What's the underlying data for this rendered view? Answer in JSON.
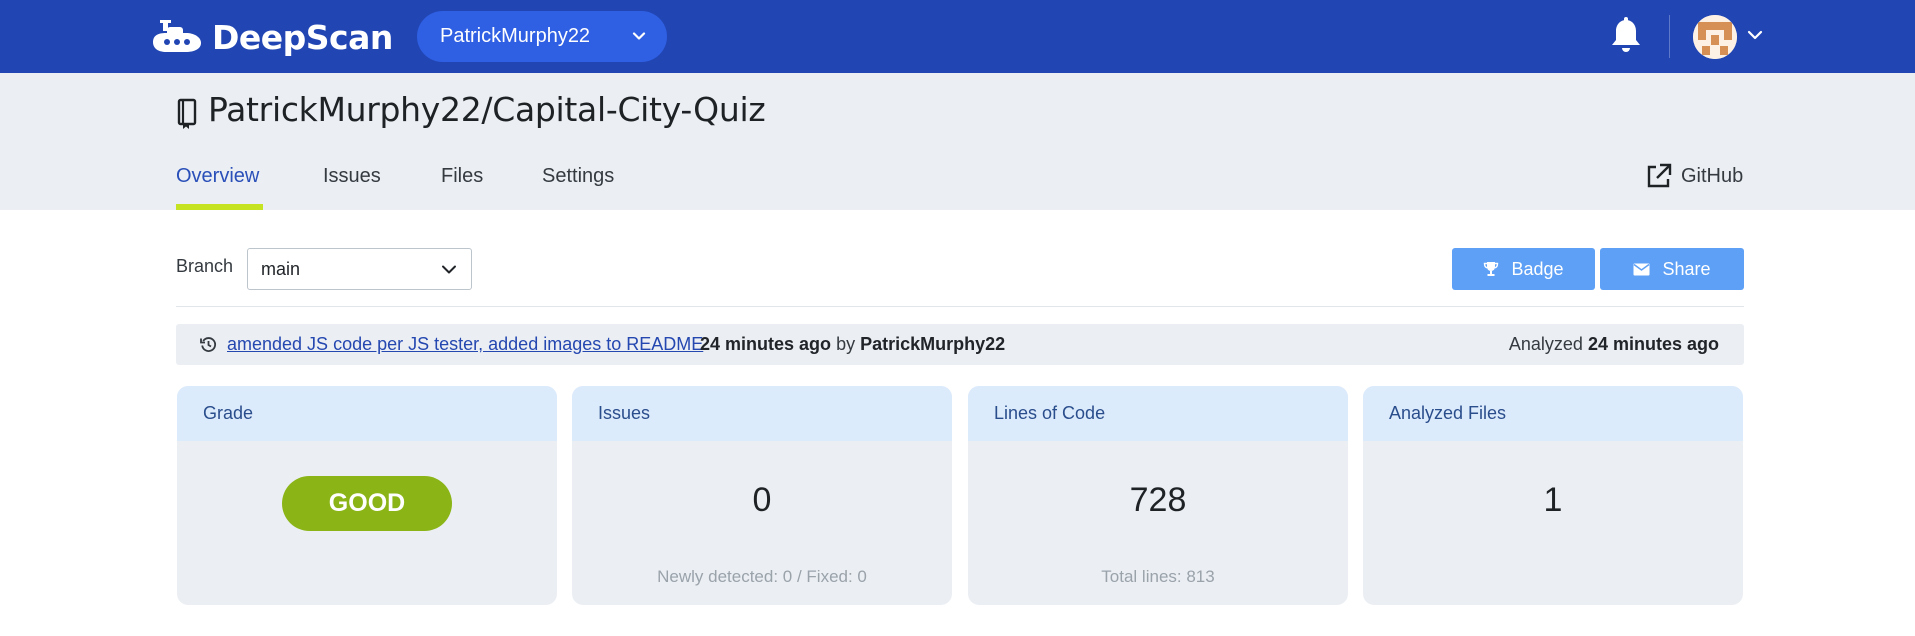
{
  "app": {
    "name": "DeepScan"
  },
  "header": {
    "org_selector": "PatrickMurphy22"
  },
  "repo": {
    "title": "PatrickMurphy22/Capital-City-Quiz",
    "tabs": [
      {
        "label": "Overview",
        "active": true
      },
      {
        "label": "Issues"
      },
      {
        "label": "Files"
      },
      {
        "label": "Settings"
      }
    ],
    "github_label": "GitHub"
  },
  "branch": {
    "label": "Branch",
    "value": "main"
  },
  "actions": {
    "badge_label": "Badge",
    "share_label": "Share"
  },
  "commit": {
    "message": "amended JS code per JS tester, added images to README",
    "time": "24 minutes ago",
    "by": "by",
    "author": "PatrickMurphy22",
    "analyzed_label": "Analyzed",
    "analyzed_time": "24 minutes ago"
  },
  "cards": {
    "grade": {
      "title": "Grade",
      "value": "GOOD"
    },
    "issues": {
      "title": "Issues",
      "value": "0",
      "sub": "Newly detected: 0  /  Fixed: 0"
    },
    "loc": {
      "title": "Lines of Code",
      "value": "728",
      "sub": "Total lines: 813"
    },
    "files": {
      "title": "Analyzed Files",
      "value": "1"
    }
  },
  "colors": {
    "topbar": "#2146b4",
    "accent_underline": "#c6e321",
    "button": "#5ea0f5",
    "grade_good": "#8bb517",
    "link": "#2447b0"
  },
  "icons": [
    "submarine-logo-icon",
    "chevron-down-icon",
    "bell-icon",
    "avatar",
    "repo-book-icon",
    "external-link-icon",
    "trophy-icon",
    "envelope-icon",
    "history-icon"
  ]
}
